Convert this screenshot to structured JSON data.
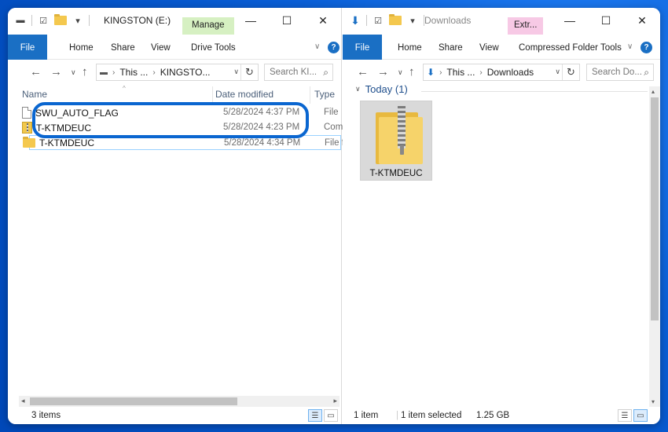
{
  "left": {
    "title": "KINGSTON (E:)",
    "context_tab": "Manage",
    "tabs": [
      "File",
      "Home",
      "Share",
      "View",
      "Drive Tools"
    ],
    "address": {
      "part1": "This ...",
      "part2": "KINGSTO..."
    },
    "search_placeholder": "Search KI...",
    "columns": {
      "name": "Name",
      "date": "Date modified",
      "type": "Type"
    },
    "rows": [
      {
        "name": "SWU_AUTO_FLAG",
        "date": "5/28/2024 4:37 PM",
        "type": "File",
        "icon": "file-icon"
      },
      {
        "name": "T-KTMDEUC",
        "date": "5/28/2024 4:23 PM",
        "type": "Compr",
        "icon": "zip-icon"
      },
      {
        "name": "T-KTMDEUC",
        "date": "5/28/2024 4:34 PM",
        "type": "File fol",
        "icon": "folder-icon"
      }
    ],
    "status": "3 items"
  },
  "right": {
    "title": "Downloads",
    "context_tab": "Extr...",
    "tabs": [
      "File",
      "Home",
      "Share",
      "View",
      "Compressed Folder Tools"
    ],
    "address": {
      "part1": "This ...",
      "part2": "Downloads"
    },
    "search_placeholder": "Search Do...",
    "group": "Today (1)",
    "item": {
      "name": "T-KTMDEUC",
      "icon": "zip-folder-icon"
    },
    "status": {
      "count": "1 item",
      "selected": "1 item selected",
      "size": "1.25 GB"
    }
  },
  "colors": {
    "accent": "#1a6fc4",
    "manage_tab": "#d6f0c2",
    "extract_tab": "#f7c9e5",
    "highlight": "#0a66d0"
  }
}
